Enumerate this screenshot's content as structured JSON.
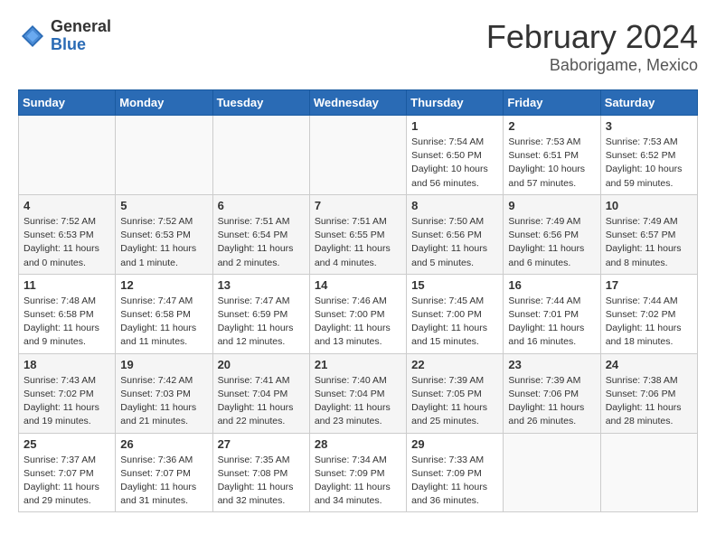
{
  "header": {
    "logo_general": "General",
    "logo_blue": "Blue",
    "month_title": "February 2024",
    "location": "Baborigame, Mexico"
  },
  "weekdays": [
    "Sunday",
    "Monday",
    "Tuesday",
    "Wednesday",
    "Thursday",
    "Friday",
    "Saturday"
  ],
  "weeks": [
    [
      {
        "day": "",
        "info": ""
      },
      {
        "day": "",
        "info": ""
      },
      {
        "day": "",
        "info": ""
      },
      {
        "day": "",
        "info": ""
      },
      {
        "day": "1",
        "info": "Sunrise: 7:54 AM\nSunset: 6:50 PM\nDaylight: 10 hours\nand 56 minutes."
      },
      {
        "day": "2",
        "info": "Sunrise: 7:53 AM\nSunset: 6:51 PM\nDaylight: 10 hours\nand 57 minutes."
      },
      {
        "day": "3",
        "info": "Sunrise: 7:53 AM\nSunset: 6:52 PM\nDaylight: 10 hours\nand 59 minutes."
      }
    ],
    [
      {
        "day": "4",
        "info": "Sunrise: 7:52 AM\nSunset: 6:53 PM\nDaylight: 11 hours\nand 0 minutes."
      },
      {
        "day": "5",
        "info": "Sunrise: 7:52 AM\nSunset: 6:53 PM\nDaylight: 11 hours\nand 1 minute."
      },
      {
        "day": "6",
        "info": "Sunrise: 7:51 AM\nSunset: 6:54 PM\nDaylight: 11 hours\nand 2 minutes."
      },
      {
        "day": "7",
        "info": "Sunrise: 7:51 AM\nSunset: 6:55 PM\nDaylight: 11 hours\nand 4 minutes."
      },
      {
        "day": "8",
        "info": "Sunrise: 7:50 AM\nSunset: 6:56 PM\nDaylight: 11 hours\nand 5 minutes."
      },
      {
        "day": "9",
        "info": "Sunrise: 7:49 AM\nSunset: 6:56 PM\nDaylight: 11 hours\nand 6 minutes."
      },
      {
        "day": "10",
        "info": "Sunrise: 7:49 AM\nSunset: 6:57 PM\nDaylight: 11 hours\nand 8 minutes."
      }
    ],
    [
      {
        "day": "11",
        "info": "Sunrise: 7:48 AM\nSunset: 6:58 PM\nDaylight: 11 hours\nand 9 minutes."
      },
      {
        "day": "12",
        "info": "Sunrise: 7:47 AM\nSunset: 6:58 PM\nDaylight: 11 hours\nand 11 minutes."
      },
      {
        "day": "13",
        "info": "Sunrise: 7:47 AM\nSunset: 6:59 PM\nDaylight: 11 hours\nand 12 minutes."
      },
      {
        "day": "14",
        "info": "Sunrise: 7:46 AM\nSunset: 7:00 PM\nDaylight: 11 hours\nand 13 minutes."
      },
      {
        "day": "15",
        "info": "Sunrise: 7:45 AM\nSunset: 7:00 PM\nDaylight: 11 hours\nand 15 minutes."
      },
      {
        "day": "16",
        "info": "Sunrise: 7:44 AM\nSunset: 7:01 PM\nDaylight: 11 hours\nand 16 minutes."
      },
      {
        "day": "17",
        "info": "Sunrise: 7:44 AM\nSunset: 7:02 PM\nDaylight: 11 hours\nand 18 minutes."
      }
    ],
    [
      {
        "day": "18",
        "info": "Sunrise: 7:43 AM\nSunset: 7:02 PM\nDaylight: 11 hours\nand 19 minutes."
      },
      {
        "day": "19",
        "info": "Sunrise: 7:42 AM\nSunset: 7:03 PM\nDaylight: 11 hours\nand 21 minutes."
      },
      {
        "day": "20",
        "info": "Sunrise: 7:41 AM\nSunset: 7:04 PM\nDaylight: 11 hours\nand 22 minutes."
      },
      {
        "day": "21",
        "info": "Sunrise: 7:40 AM\nSunset: 7:04 PM\nDaylight: 11 hours\nand 23 minutes."
      },
      {
        "day": "22",
        "info": "Sunrise: 7:39 AM\nSunset: 7:05 PM\nDaylight: 11 hours\nand 25 minutes."
      },
      {
        "day": "23",
        "info": "Sunrise: 7:39 AM\nSunset: 7:06 PM\nDaylight: 11 hours\nand 26 minutes."
      },
      {
        "day": "24",
        "info": "Sunrise: 7:38 AM\nSunset: 7:06 PM\nDaylight: 11 hours\nand 28 minutes."
      }
    ],
    [
      {
        "day": "25",
        "info": "Sunrise: 7:37 AM\nSunset: 7:07 PM\nDaylight: 11 hours\nand 29 minutes."
      },
      {
        "day": "26",
        "info": "Sunrise: 7:36 AM\nSunset: 7:07 PM\nDaylight: 11 hours\nand 31 minutes."
      },
      {
        "day": "27",
        "info": "Sunrise: 7:35 AM\nSunset: 7:08 PM\nDaylight: 11 hours\nand 32 minutes."
      },
      {
        "day": "28",
        "info": "Sunrise: 7:34 AM\nSunset: 7:09 PM\nDaylight: 11 hours\nand 34 minutes."
      },
      {
        "day": "29",
        "info": "Sunrise: 7:33 AM\nSunset: 7:09 PM\nDaylight: 11 hours\nand 36 minutes."
      },
      {
        "day": "",
        "info": ""
      },
      {
        "day": "",
        "info": ""
      }
    ]
  ]
}
